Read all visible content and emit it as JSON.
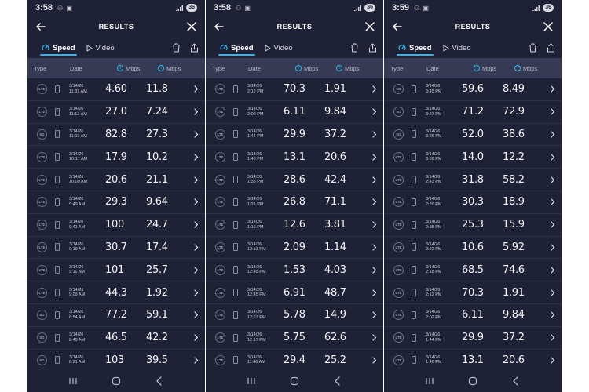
{
  "screens": [
    {
      "time": "3:58",
      "battery": "36",
      "header": {
        "title": "RESULTS"
      },
      "tabs": [
        {
          "label": "Speed",
          "active": true
        },
        {
          "label": "Video",
          "active": false
        }
      ],
      "columns": {
        "type": "Type",
        "date": "Date",
        "download": "Mbps",
        "upload": "Mbps"
      },
      "rows": [
        {
          "tech": "LTE",
          "date": "3/14/26",
          "time": "11:31 AM",
          "down": "4.60",
          "up": "11.8"
        },
        {
          "tech": "LTE",
          "date": "3/14/26",
          "time": "11:12 AM",
          "down": "27.0",
          "up": "7.24"
        },
        {
          "tech": "5G",
          "date": "3/14/26",
          "time": "11:07 AM",
          "down": "82.8",
          "up": "27.3"
        },
        {
          "tech": "LTE",
          "date": "3/14/26",
          "time": "10:17 AM",
          "down": "17.9",
          "up": "10.2"
        },
        {
          "tech": "LTE",
          "date": "3/14/26",
          "time": "10:09 AM",
          "down": "20.6",
          "up": "21.1"
        },
        {
          "tech": "LTE",
          "date": "3/14/26",
          "time": "9:49 AM",
          "down": "29.3",
          "up": "9.64"
        },
        {
          "tech": "LTE",
          "date": "3/14/26",
          "time": "9:41 AM",
          "down": "100",
          "up": "24.7"
        },
        {
          "tech": "LTE",
          "date": "3/14/26",
          "time": "9:19 AM",
          "down": "30.7",
          "up": "17.4"
        },
        {
          "tech": "LTE",
          "date": "3/14/26",
          "time": "9:11 AM",
          "down": "101",
          "up": "25.7"
        },
        {
          "tech": "LTE",
          "date": "3/14/26",
          "time": "9:09 AM",
          "down": "44.3",
          "up": "1.92"
        },
        {
          "tech": "5G",
          "date": "3/14/26",
          "time": "8:54 AM",
          "down": "77.2",
          "up": "59.1"
        },
        {
          "tech": "5G",
          "date": "3/14/26",
          "time": "8:40 AM",
          "down": "46.5",
          "up": "42.2"
        },
        {
          "tech": "5G",
          "date": "3/14/26",
          "time": "8:21 AM",
          "down": "103",
          "up": "39.5"
        }
      ]
    },
    {
      "time": "3:58",
      "battery": "36",
      "header": {
        "title": "RESULTS"
      },
      "tabs": [
        {
          "label": "Speed",
          "active": true
        },
        {
          "label": "Video",
          "active": false
        }
      ],
      "columns": {
        "type": "Type",
        "date": "Date",
        "download": "Mbps",
        "upload": "Mbps"
      },
      "rows": [
        {
          "tech": "LTE",
          "date": "3/14/26",
          "time": "2:12 PM",
          "down": "70.3",
          "up": "1.91"
        },
        {
          "tech": "LTE",
          "date": "3/14/26",
          "time": "2:02 PM",
          "down": "6.11",
          "up": "9.84"
        },
        {
          "tech": "LTE",
          "date": "3/14/26",
          "time": "1:44 PM",
          "down": "29.9",
          "up": "37.2"
        },
        {
          "tech": "LTE",
          "date": "3/14/26",
          "time": "1:40 PM",
          "down": "13.1",
          "up": "20.6"
        },
        {
          "tech": "LTE",
          "date": "3/14/26",
          "time": "1:33 PM",
          "down": "28.6",
          "up": "42.4"
        },
        {
          "tech": "LTE",
          "date": "3/14/26",
          "time": "1:21 PM",
          "down": "26.8",
          "up": "71.1"
        },
        {
          "tech": "LTE",
          "date": "3/14/26",
          "time": "1:16 PM",
          "down": "12.6",
          "up": "3.81"
        },
        {
          "tech": "LTE",
          "date": "3/14/26",
          "time": "12:53 PM",
          "down": "2.09",
          "up": "1.14"
        },
        {
          "tech": "LTE",
          "date": "3/14/26",
          "time": "12:48 PM",
          "down": "1.53",
          "up": "4.03"
        },
        {
          "tech": "LTE",
          "date": "3/14/26",
          "time": "12:45 PM",
          "down": "6.91",
          "up": "48.7"
        },
        {
          "tech": "LTE",
          "date": "3/14/26",
          "time": "12:27 PM",
          "down": "5.78",
          "up": "14.9"
        },
        {
          "tech": "LTE",
          "date": "3/14/26",
          "time": "12:17 PM",
          "down": "5.75",
          "up": "62.6"
        },
        {
          "tech": "LTE",
          "date": "3/14/26",
          "time": "11:46 AM",
          "down": "29.4",
          "up": "25.2"
        }
      ]
    },
    {
      "time": "3:59",
      "battery": "36",
      "header": {
        "title": "RESULTS"
      },
      "tabs": [
        {
          "label": "Speed",
          "active": true
        },
        {
          "label": "Video",
          "active": false
        }
      ],
      "columns": {
        "type": "Type",
        "date": "Date",
        "download": "Mbps",
        "upload": "Mbps"
      },
      "rows": [
        {
          "tech": "5G",
          "date": "3/14/26",
          "time": "3:45 PM",
          "down": "59.6",
          "up": "8.49"
        },
        {
          "tech": "5G",
          "date": "3/14/26",
          "time": "3:27 PM",
          "down": "71.2",
          "up": "72.9"
        },
        {
          "tech": "5G",
          "date": "3/14/26",
          "time": "3:26 PM",
          "down": "52.0",
          "up": "38.6"
        },
        {
          "tech": "LTE",
          "date": "3/14/26",
          "time": "3:06 PM",
          "down": "14.0",
          "up": "12.2"
        },
        {
          "tech": "LTE",
          "date": "3/14/26",
          "time": "2:43 PM",
          "down": "31.8",
          "up": "58.2"
        },
        {
          "tech": "LTE",
          "date": "3/14/26",
          "time": "2:39 PM",
          "down": "30.3",
          "up": "18.9"
        },
        {
          "tech": "LTE",
          "date": "3/14/26",
          "time": "2:38 PM",
          "down": "25.3",
          "up": "15.9"
        },
        {
          "tech": "LTE",
          "date": "3/14/26",
          "time": "2:22 PM",
          "down": "10.6",
          "up": "5.92"
        },
        {
          "tech": "LTE",
          "date": "3/14/26",
          "time": "2:18 PM",
          "down": "68.5",
          "up": "74.6"
        },
        {
          "tech": "LTE",
          "date": "3/14/26",
          "time": "2:12 PM",
          "down": "70.3",
          "up": "1.91"
        },
        {
          "tech": "LTE",
          "date": "3/14/26",
          "time": "2:02 PM",
          "down": "6.11",
          "up": "9.84"
        },
        {
          "tech": "LTE",
          "date": "3/14/26",
          "time": "1:44 PM",
          "down": "29.9",
          "up": "37.2"
        },
        {
          "tech": "LTE",
          "date": "3/14/26",
          "time": "1:40 PM",
          "down": "13.1",
          "up": "20.6"
        }
      ]
    }
  ],
  "colors": {
    "background": "#1f2236",
    "header_row": "#363a54",
    "accent": "#2fb8e6"
  },
  "icons": [
    "back-arrow-icon",
    "close-icon",
    "speed-gauge-icon",
    "play-icon",
    "trash-icon",
    "share-icon",
    "download-arrow-icon",
    "upload-arrow-icon",
    "phone-icon",
    "chevron-right-icon",
    "recents-icon",
    "home-icon",
    "back-icon"
  ]
}
